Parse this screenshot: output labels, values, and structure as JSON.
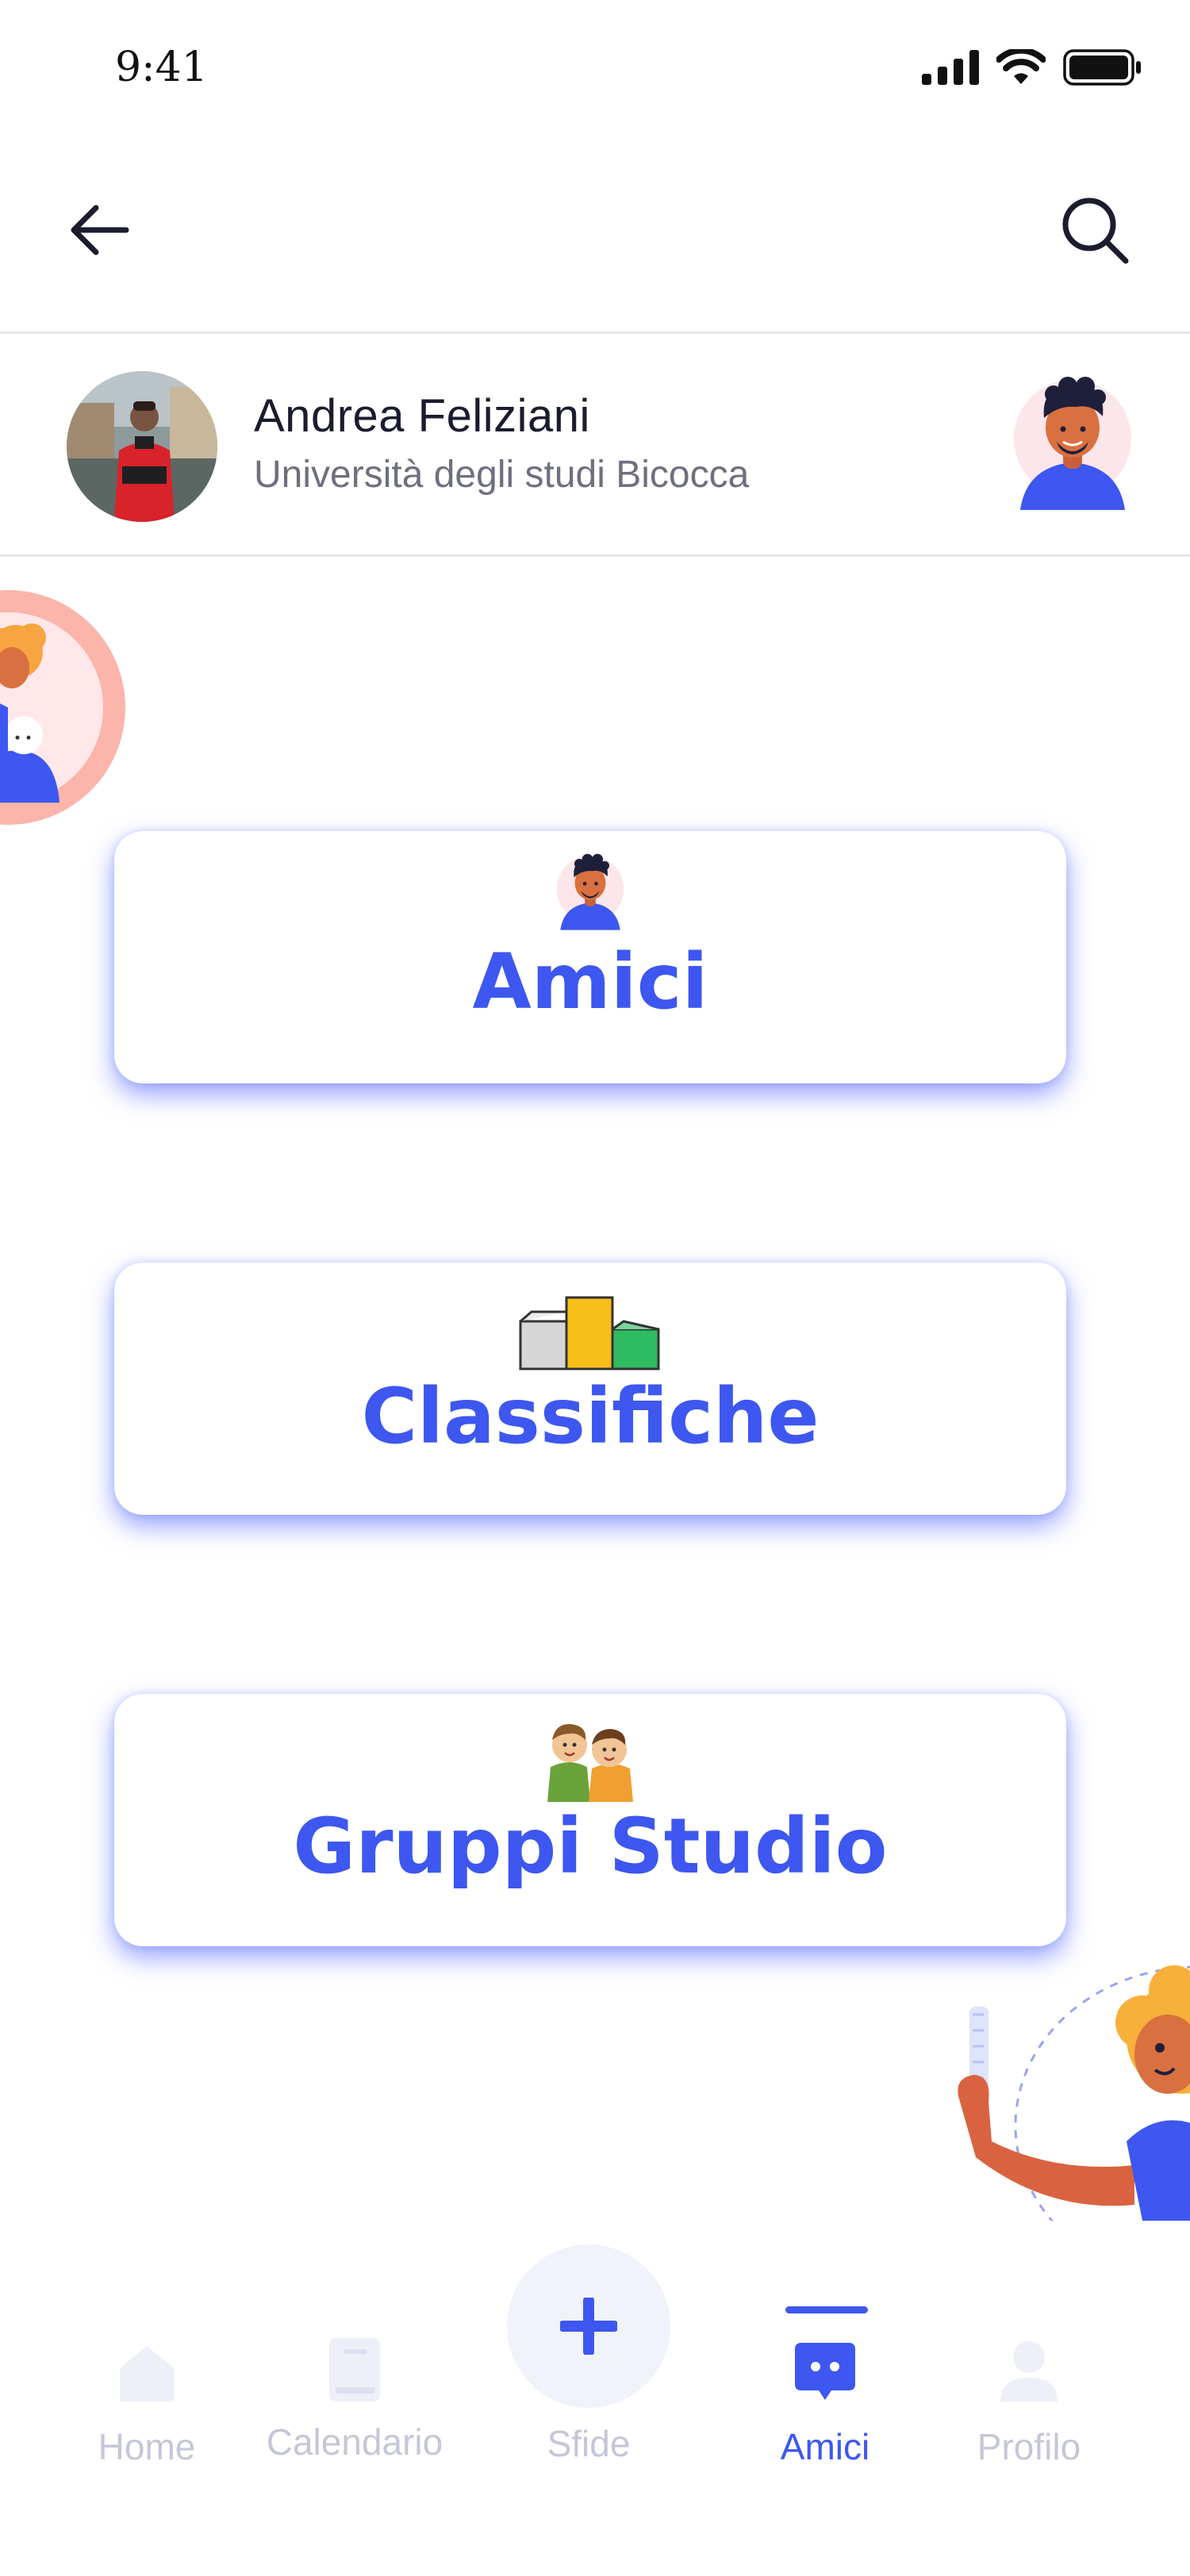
{
  "status_bar": {
    "time": "9:41"
  },
  "profile": {
    "name": "Andrea Feliziani",
    "university": "Università degli studi Bicocca"
  },
  "cards": [
    {
      "label": "Amici",
      "icon": "friend-avatar-icon"
    },
    {
      "label": "Classifiche",
      "icon": "podium-icon"
    },
    {
      "label": "Gruppi Studio",
      "icon": "study-group-icon"
    }
  ],
  "bottom_nav": {
    "items": [
      {
        "label": "Home",
        "icon": "home-icon",
        "active": false
      },
      {
        "label": "Calendario",
        "icon": "book-icon",
        "active": false
      },
      {
        "label": "Sfide",
        "icon": "plus-icon",
        "active": false
      },
      {
        "label": "Amici",
        "icon": "chat-icon",
        "active": true
      },
      {
        "label": "Profilo",
        "icon": "user-icon",
        "active": false
      }
    ]
  },
  "colors": {
    "accent": "#3D57F0",
    "inactive": "#C5C7D8",
    "divider": "#E6E7EE"
  }
}
